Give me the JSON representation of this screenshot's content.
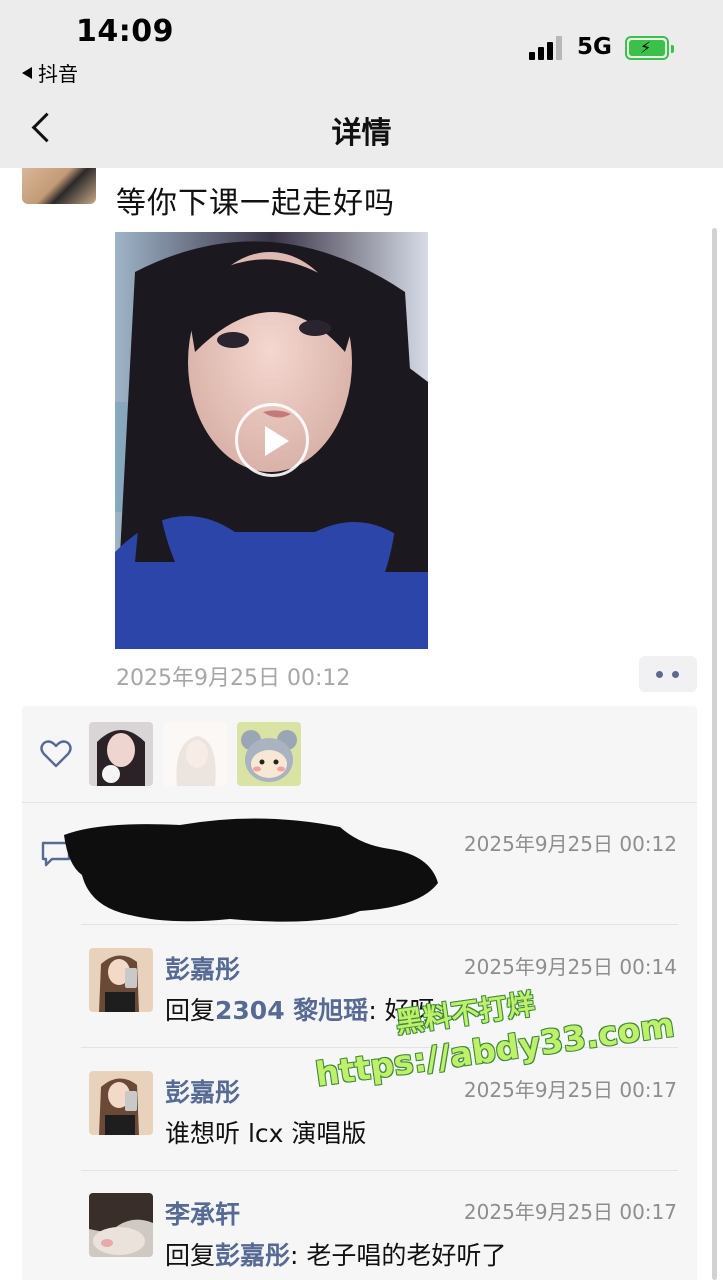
{
  "status_bar": {
    "time": "14:09",
    "back_app": "抖音",
    "network": "5G",
    "battery_color": "#3bc04a"
  },
  "header": {
    "back_icon": "chevron-left-icon",
    "title": "详情"
  },
  "post": {
    "text": "等你下课一起走好吗",
    "video_icon": "play-icon",
    "timestamp": "2025年9月25日 00:12",
    "more_icon": "more-dots-icon"
  },
  "likes": {
    "icon": "heart-icon",
    "count_avatars": 3
  },
  "comments": {
    "icon": "comment-icon",
    "first": {
      "author": "",
      "timestamp": "2025年9月25日 00:12",
      "redacted": true
    },
    "items": [
      {
        "author": "彭嘉彤",
        "timestamp": "2025年9月25日 00:14",
        "reply_prefix": "回复",
        "reply_to": "2304 黎旭瑶",
        "text": ": 好呀"
      },
      {
        "author": "彭嘉彤",
        "timestamp": "2025年9月25日 00:17",
        "text": "谁想听 lcx 演唱版"
      },
      {
        "author": "李承轩",
        "timestamp": "2025年9月25日 00:17",
        "reply_prefix": "回复",
        "reply_to": "彭嘉彤",
        "text": ": 老子唱的老好听了"
      }
    ]
  },
  "watermark": {
    "line1": "黑料不打烊",
    "line2": "https://abdy33.com"
  },
  "colors": {
    "link_blue": "#566a94",
    "panel_bg": "#f6f6f6",
    "meta_gray": "#8e8e8e"
  }
}
